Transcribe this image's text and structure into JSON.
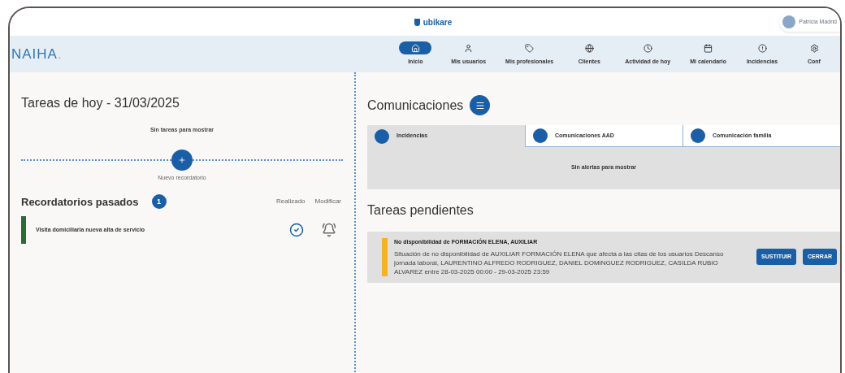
{
  "header": {
    "logo": "ubikare",
    "user": "Patricia Madrid"
  },
  "brand": {
    "name": "NAIHA",
    "dot": "."
  },
  "nav": [
    {
      "label": "Inicio",
      "selected": true
    },
    {
      "label": "Mis usuarios",
      "selected": false
    },
    {
      "label": "Mis profesionales",
      "selected": false
    },
    {
      "label": "Clientes",
      "selected": false
    },
    {
      "label": "Actividad de hoy",
      "selected": false
    },
    {
      "label": "Mi calendario",
      "selected": false
    },
    {
      "label": "Incidencias",
      "selected": false
    },
    {
      "label": "Conf",
      "selected": false
    }
  ],
  "today": {
    "title": "Tareas de hoy - 31/03/2025",
    "empty": "Sin tareas para mostrar",
    "new_label": "Nuevo recordatorio"
  },
  "past": {
    "title": "Recordatorios pasados",
    "count": "1",
    "col_done": "Realizado",
    "col_edit": "Modificar",
    "items": [
      {
        "text": "Visita domiciliaria nueva alta de servicio",
        "color": "#2e6b34"
      }
    ]
  },
  "communications": {
    "title": "Comunicaciones",
    "tabs": [
      {
        "label": "Incidencias",
        "selected": true
      },
      {
        "label": "Comunicaciones AAD",
        "selected": false
      },
      {
        "label": "Comunicación familia",
        "selected": false
      }
    ],
    "empty": "Sin alertas para mostrar"
  },
  "pending": {
    "title": "Tareas pendientes",
    "items": [
      {
        "title": "No disponibilidad de FORMACIÓN ELENA, AUXILIAR",
        "description": "Situación de no disponibilidad de AUXILIAR FORMACIÓN ELENA que afecta a las citas de los usuarios Descanso jornada laboral, LAURENTINO ALFREDO RODRIGUEZ, DANIEL DOMINGUEZ RODRIGUEZ, CASILDA RUBIO ALVAREZ entre 28-03-2025 00:00 - 29-03-2025 23:59",
        "color": "#f5b324",
        "buttons": [
          "SUSTITUIR",
          "CERRAR"
        ]
      }
    ]
  }
}
